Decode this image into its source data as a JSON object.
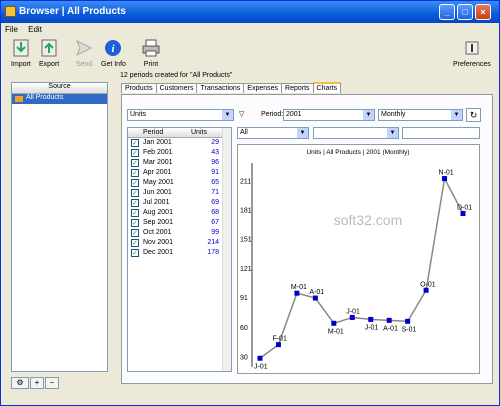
{
  "window": {
    "title": "Browser | All Products"
  },
  "menu": [
    "File",
    "Edit"
  ],
  "toolbar": {
    "import": "Import",
    "export": "Export",
    "send": "Send",
    "get_info": "Get Info",
    "print": "Print",
    "preferences": "Preferences"
  },
  "sidebar": {
    "header": "Source",
    "item": "All Products"
  },
  "info_text": "12 periods created for \"All Products\"",
  "tabs": [
    "Products",
    "Customers",
    "Transactions",
    "Expenses",
    "Reports",
    "Charts"
  ],
  "controls": {
    "measure": "Units",
    "period_label": "Period:",
    "period": "2001",
    "interval": "Monthly",
    "filter": "All"
  },
  "list": {
    "col_period": "Period",
    "col_units": "Units",
    "rows": [
      {
        "period": "Jan 2001",
        "units": "29"
      },
      {
        "period": "Feb 2001",
        "units": "43"
      },
      {
        "period": "Mar 2001",
        "units": "96"
      },
      {
        "period": "Apr 2001",
        "units": "91"
      },
      {
        "period": "May 2001",
        "units": "65"
      },
      {
        "period": "Jun 2001",
        "units": "71"
      },
      {
        "period": "Jul 2001",
        "units": "69"
      },
      {
        "period": "Aug 2001",
        "units": "68"
      },
      {
        "period": "Sep 2001",
        "units": "67"
      },
      {
        "period": "Oct 2001",
        "units": "99"
      },
      {
        "period": "Nov 2001",
        "units": "214"
      },
      {
        "period": "Dec 2001",
        "units": "178"
      }
    ]
  },
  "chart_data": {
    "type": "line",
    "title": "Units | All Products | 2001 (Monthly)",
    "x": [
      "J-01",
      "F-01",
      "M-01",
      "A-01",
      "M-01",
      "J-01",
      "J-01",
      "A-01",
      "S-01",
      "O-01",
      "N-01",
      "D-01"
    ],
    "values": [
      29,
      43,
      96,
      91,
      65,
      71,
      69,
      68,
      67,
      99,
      214,
      178
    ],
    "yticks": [
      "30",
      "60",
      "91",
      "121",
      "151",
      "181",
      "211"
    ],
    "ylim": [
      20,
      230
    ],
    "grid": false,
    "line_color": "#888888",
    "marker_color": "#0000cc"
  },
  "watermark": "soft32.com"
}
